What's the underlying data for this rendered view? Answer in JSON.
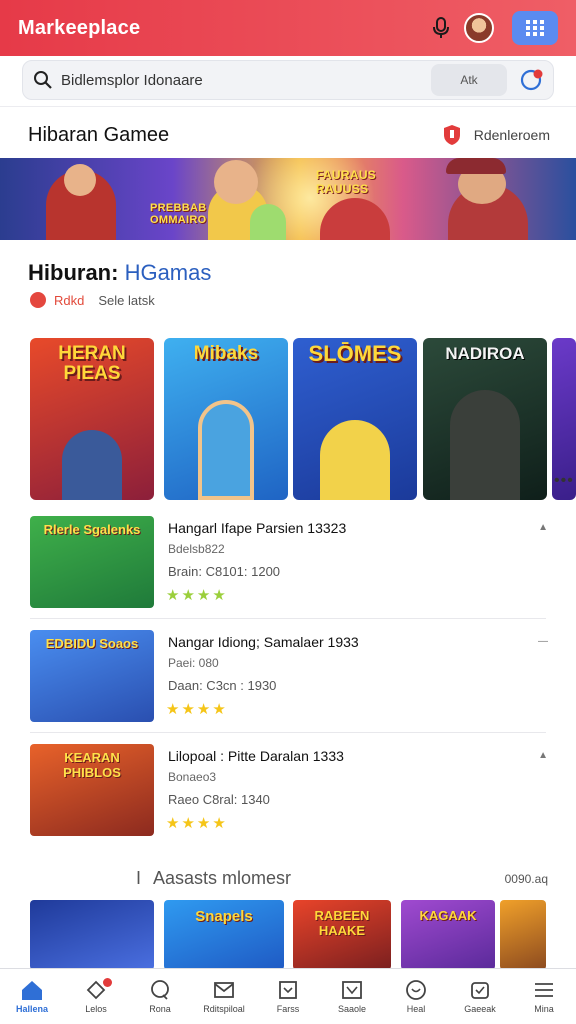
{
  "colors": {
    "appbar": "#e63a48",
    "accent_blue": "#2f6fd6",
    "star": "#f5c518",
    "badge_red": "#e23b3b"
  },
  "appbar": {
    "title": "Markeeplace",
    "mic_icon": "microphone-icon",
    "avatar": "user-avatar",
    "grid_icon": "apps-grid-icon"
  },
  "search": {
    "placeholder": "Bidlemsplor Idonaare",
    "camera_label": "Atk",
    "search_icon": "search-icon",
    "cart_icon": "cart-icon"
  },
  "section_top": {
    "title": "Hibaran Gamee",
    "link_label": "Rdenleroem",
    "link_icon": "shield-badge-icon"
  },
  "banner": {
    "text_left": "PREBBAB\nOMMAIRO",
    "text_right": "FAURAUS\nRAUUSS"
  },
  "section_games": {
    "title": "Hiburan:",
    "title_accent": " HGamas",
    "sub_badge": "Rdkd",
    "sub_text": "Sele latsk",
    "cards": [
      {
        "title": "HERAN PIEAS"
      },
      {
        "title": "Mibaks"
      },
      {
        "title": "SLŌMES"
      },
      {
        "title": "NADIROA"
      }
    ],
    "more": "•••"
  },
  "list": [
    {
      "thumb_title": "Rlerle Sgalenks",
      "name": "Hangarl Ifape Parsien 13323",
      "meta1": "Bdelsb822",
      "meta2": "Brain: C8101: 1200",
      "stars": "★★★★"
    },
    {
      "thumb_title": "EDBIDU Soaos",
      "name": "Nangar Idiong; Samalaer 1933",
      "meta1": "Paei: 080",
      "meta2": "Daan: C3cn : 1930",
      "stars": "★★★★"
    },
    {
      "thumb_title": "KEARAN PHIBLOS",
      "name": "Lilopoal : Pitte Daralan 1333",
      "meta1": "Bonaeo3",
      "meta2": "Raeo C8ral: 1340",
      "stars": "★★★★"
    }
  ],
  "section_bottom": {
    "prefix": "I",
    "title": "Aasasts mlomesr",
    "more": "0090.aq",
    "cards": [
      {
        "title": ""
      },
      {
        "title": "Snapels"
      },
      {
        "title": "RABEEN HAAKE"
      },
      {
        "title": "KAGAAK"
      },
      {
        "title": ""
      }
    ]
  },
  "bottom_nav": [
    {
      "label": "Hallena",
      "icon": "home-icon",
      "active": true
    },
    {
      "label": "Lelos",
      "icon": "notification-icon",
      "active": false,
      "badge": true
    },
    {
      "label": "Rona",
      "icon": "chat-icon",
      "active": false
    },
    {
      "label": "Rditspiloal",
      "icon": "mail-icon",
      "active": false
    },
    {
      "label": "Farss",
      "icon": "tag-icon",
      "active": false
    },
    {
      "label": "Saaole",
      "icon": "inbox-icon",
      "active": false
    },
    {
      "label": "Heal",
      "icon": "heart-icon",
      "active": false
    },
    {
      "label": "Gaeeak",
      "icon": "gift-icon",
      "active": false
    },
    {
      "label": "Mina",
      "icon": "menu-icon",
      "active": false
    }
  ]
}
